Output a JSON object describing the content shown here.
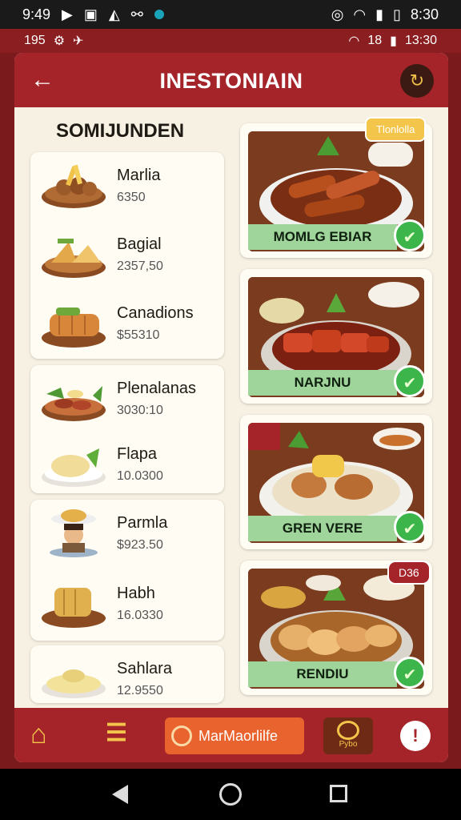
{
  "status": {
    "time": "9:49",
    "right_time": "8:30"
  },
  "subbar": {
    "left": "195",
    "right_time": "13:30",
    "right_num": "18"
  },
  "header": {
    "title": "INESTONIAIN"
  },
  "section": {
    "title": "SOMIJUNDEN"
  },
  "list": [
    {
      "name": "Marlia",
      "price": "6350"
    },
    {
      "name": "Bagial",
      "price": "2357,50"
    },
    {
      "name": "Canadions",
      "price": "$55310"
    },
    {
      "name": "Plenalanas",
      "price": "3030:10"
    },
    {
      "name": "Flapa",
      "price": "10.0300"
    },
    {
      "name": "Parmla",
      "price": "$923.50"
    },
    {
      "name": "Habh",
      "price": "16.0330"
    },
    {
      "name": "Sahlara",
      "price": "12.9550"
    }
  ],
  "cards": [
    {
      "label": "MOMLG EBIAR"
    },
    {
      "label": "NARJNU"
    },
    {
      "label": "GREN VERE"
    },
    {
      "label": "RENDIU"
    }
  ],
  "badges": {
    "top": "Tlonlolla",
    "bottom": "D36"
  },
  "bottomnav": {
    "search_label": "MarMaorlilfe",
    "promo_label": "Pybo"
  },
  "colors": {
    "primary": "#a5242a",
    "accent": "#f3c64b",
    "label_green": "#9fd49a",
    "check_green": "#3cb54a",
    "search_orange": "#e8632e"
  }
}
